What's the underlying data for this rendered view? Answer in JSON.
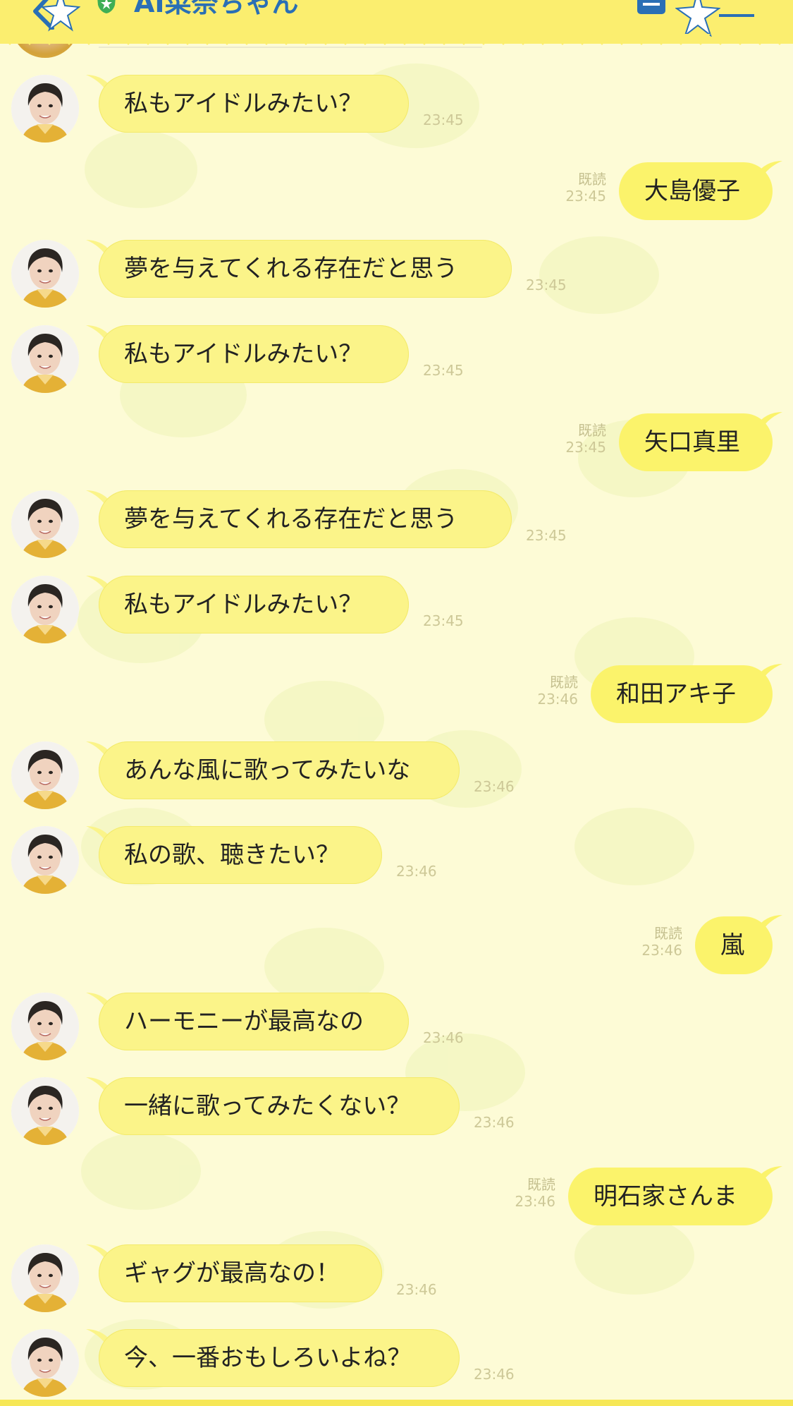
{
  "header": {
    "title": "AI菜奈ちゃん",
    "icons": {
      "back": "chevron-left-icon",
      "verified": "shield-star-icon",
      "notes": "notes-icon",
      "menu": "menu-icon"
    }
  },
  "colors": {
    "header_bg": "#fbee6f",
    "title": "#2a6fb5",
    "background": "#fdfbd6",
    "bubble": "#fbf489",
    "bubble_outgoing": "#fbf36b",
    "time": "#cdc897"
  },
  "messages": [
    {
      "from": "bot",
      "text": "私もアイドルみたい？",
      "time": "23:45"
    },
    {
      "from": "me",
      "text": "大島優子",
      "read": "既読",
      "time": "23:45"
    },
    {
      "from": "bot",
      "text": "夢を与えてくれる存在だと思う",
      "time": "23:45"
    },
    {
      "from": "bot",
      "text": "私もアイドルみたい？",
      "time": "23:45"
    },
    {
      "from": "me",
      "text": "矢口真里",
      "read": "既読",
      "time": "23:45"
    },
    {
      "from": "bot",
      "text": "夢を与えてくれる存在だと思う",
      "time": "23:45"
    },
    {
      "from": "bot",
      "text": "私もアイドルみたい？",
      "time": "23:45"
    },
    {
      "from": "me",
      "text": "和田アキ子",
      "read": "既読",
      "time": "23:46"
    },
    {
      "from": "bot",
      "text": "あんな風に歌ってみたいな",
      "time": "23:46"
    },
    {
      "from": "bot",
      "text": "私の歌、聴きたい？",
      "time": "23:46"
    },
    {
      "from": "me",
      "text": "嵐",
      "read": "既読",
      "time": "23:46"
    },
    {
      "from": "bot",
      "text": "ハーモニーが最高なの",
      "time": "23:46"
    },
    {
      "from": "bot",
      "text": "一緒に歌ってみたくない？",
      "time": "23:46"
    },
    {
      "from": "me",
      "text": "明石家さんま",
      "read": "既読",
      "time": "23:46"
    },
    {
      "from": "bot",
      "text": "ギャグが最高なの！",
      "time": "23:46"
    },
    {
      "from": "bot",
      "text": "今、一番おもしろいよね？",
      "time": "23:46"
    }
  ]
}
